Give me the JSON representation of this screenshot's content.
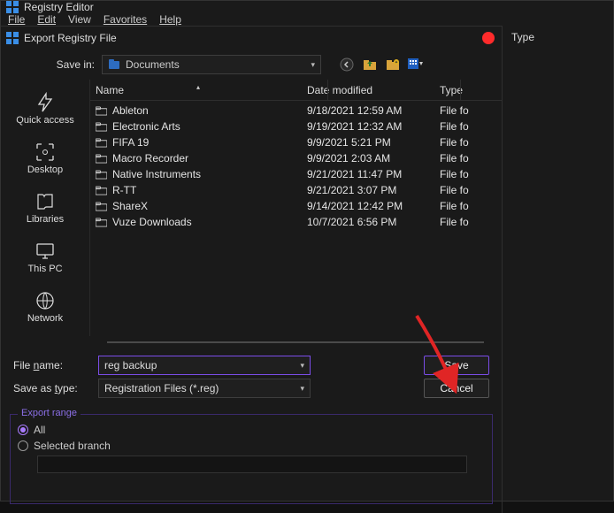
{
  "app": {
    "title": "Registry Editor"
  },
  "menu": {
    "file": "File",
    "edit": "Edit",
    "view": "View",
    "favorites": "Favorites",
    "help": "Help"
  },
  "dialog": {
    "title": "Export Registry File",
    "save_in_label": "Save in:",
    "save_in_value": "Documents",
    "places": {
      "quick_access": "Quick access",
      "desktop": "Desktop",
      "libraries": "Libraries",
      "this_pc": "This PC",
      "network": "Network"
    },
    "columns": {
      "name": "Name",
      "date": "Date modified",
      "type": "Type"
    },
    "rows": [
      {
        "name": "Ableton",
        "date": "9/18/2021 12:59 AM",
        "type": "File fo"
      },
      {
        "name": "Electronic Arts",
        "date": "9/19/2021 12:32 AM",
        "type": "File fo"
      },
      {
        "name": "FIFA 19",
        "date": "9/9/2021 5:21 PM",
        "type": "File fo"
      },
      {
        "name": "Macro Recorder",
        "date": "9/9/2021 2:03 AM",
        "type": "File fo"
      },
      {
        "name": "Native Instruments",
        "date": "9/21/2021 11:47 PM",
        "type": "File fo"
      },
      {
        "name": "R-TT",
        "date": "9/21/2021 3:07 PM",
        "type": "File fo"
      },
      {
        "name": "ShareX",
        "date": "9/14/2021 12:42 PM",
        "type": "File fo"
      },
      {
        "name": "Vuze Downloads",
        "date": "10/7/2021 6:56 PM",
        "type": "File fo"
      }
    ],
    "filename_label": "File name:",
    "filename_value": "reg backup",
    "saveastype_label": "Save as type:",
    "saveastype_value": "Registration Files (*.reg)",
    "save_btn": "Save",
    "cancel_btn": "Cancel",
    "export_range": {
      "legend": "Export range",
      "all": "All",
      "selected_branch": "Selected branch"
    }
  },
  "right_pane": {
    "type_header": "Type"
  },
  "icons": {
    "documents": "documents-icon",
    "back": "back-icon",
    "up": "up-folder-icon",
    "newfolder": "new-folder-icon",
    "viewmenu": "view-menu-icon"
  }
}
